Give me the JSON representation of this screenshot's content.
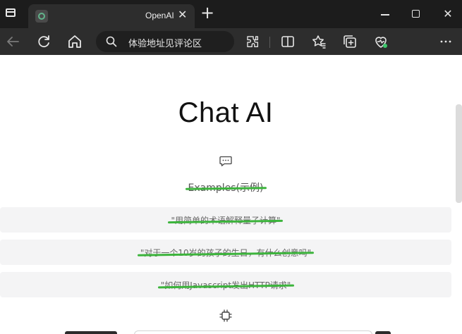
{
  "browser": {
    "tab": {
      "title": "OpenAI",
      "close_symbol": "✕"
    },
    "new_tab_symbol": "+",
    "window": {
      "close_symbol": "✕"
    },
    "address_bar": {
      "text": "体验地址见评论区"
    },
    "colors": {
      "titlebar": "#1c1c1c",
      "toolbar": "#2d2d2d",
      "tab": "#2d2d2d"
    }
  },
  "page": {
    "heading": "Chat AI",
    "examples_label": "Examples(示例)",
    "examples": [
      "\"用简单的术语解释量子计算\"",
      "\"对于一个10岁的孩子的生日，有什么创意吗\"",
      "\"如何用Javascript发出HTTP请求\""
    ],
    "strike_color": "#3cb43c"
  }
}
